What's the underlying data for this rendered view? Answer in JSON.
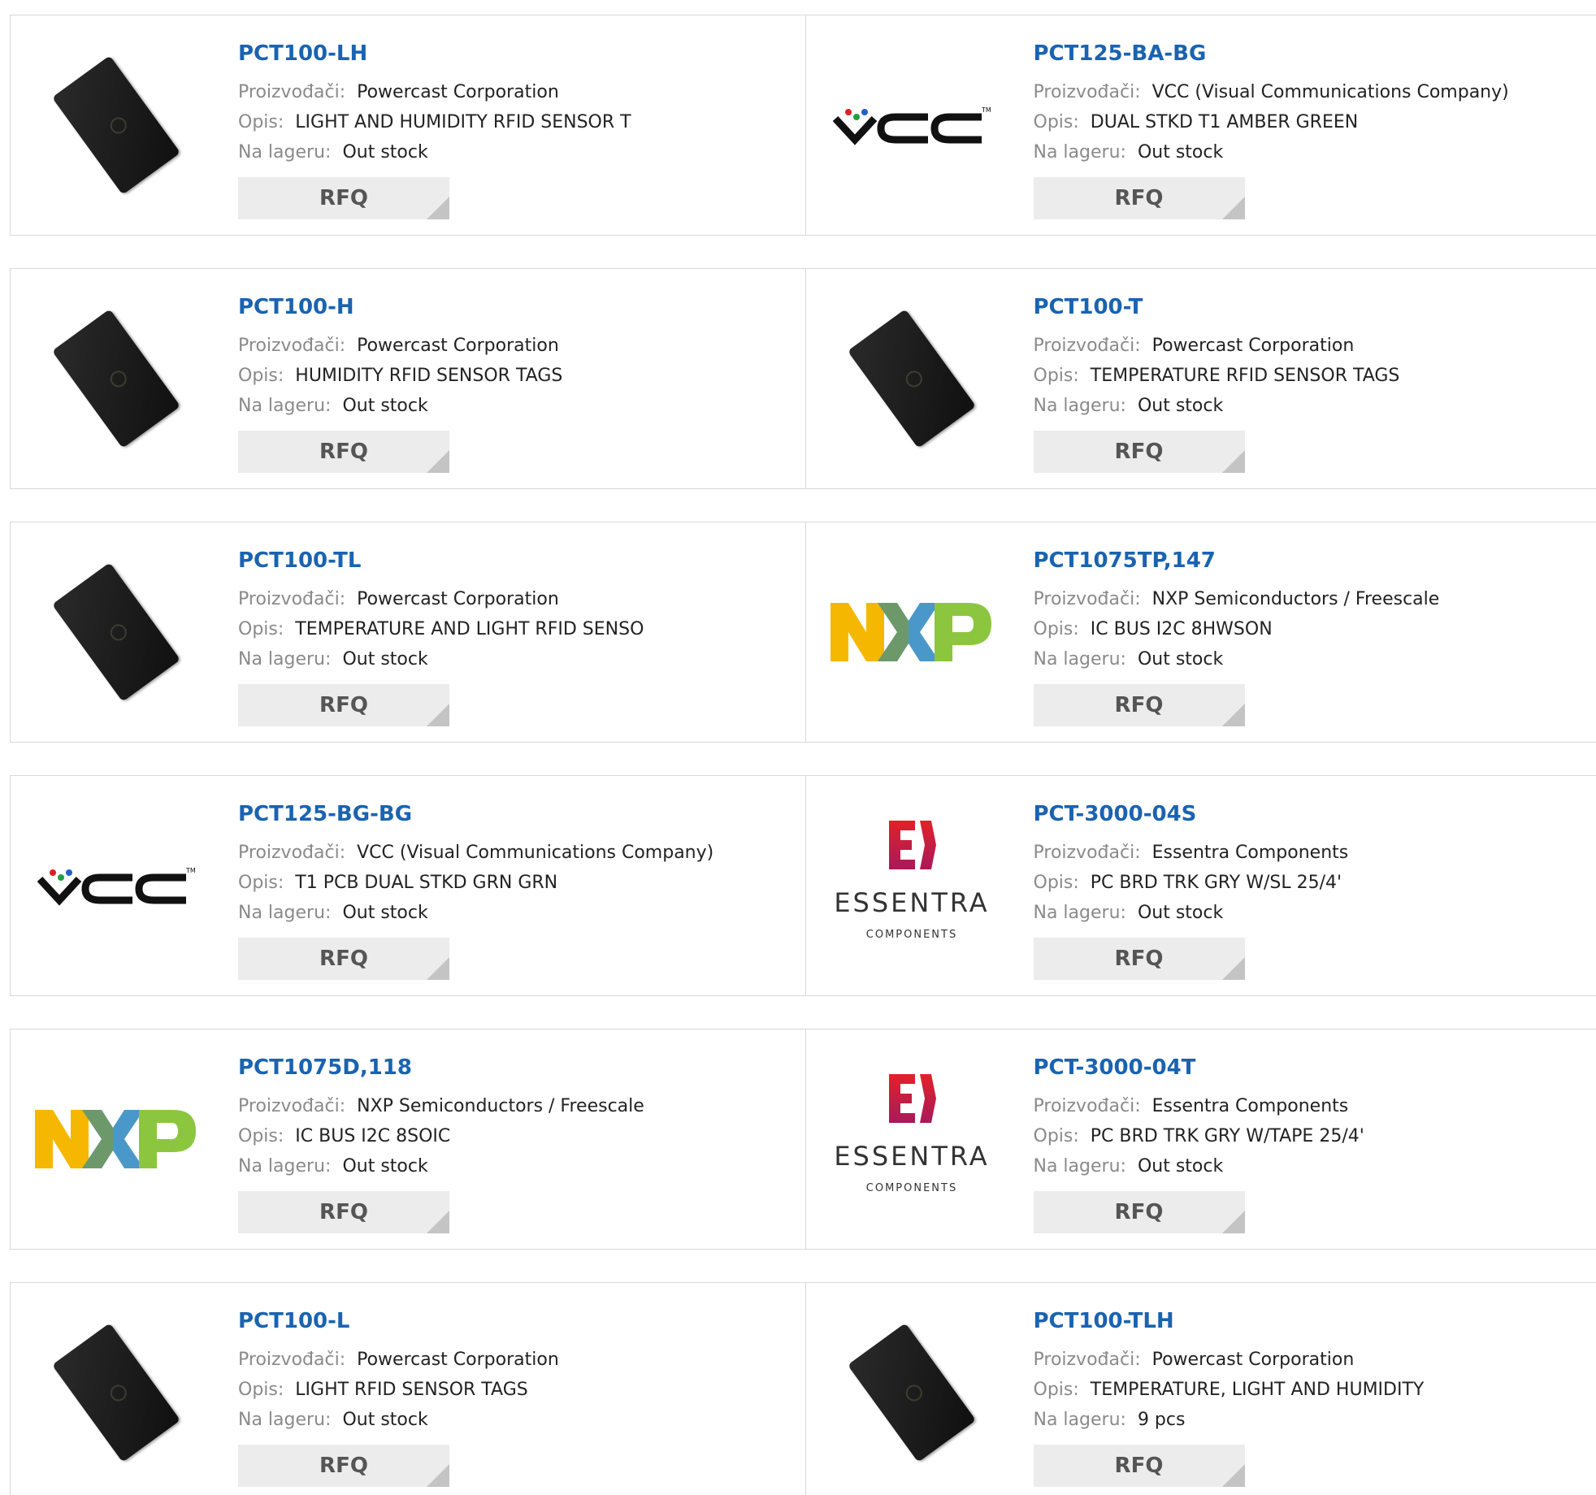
{
  "labels": {
    "manufacturer": "Proizvođači:",
    "description": "Opis:",
    "stock": "Na lageru:",
    "rfq": "RFQ"
  },
  "colors": {
    "title_link": "#1a63b0",
    "label_gray": "#8a8a8a",
    "button_bg": "#ececec",
    "border": "#d9d9d9"
  },
  "products": [
    {
      "part": "PCT100-LH",
      "manufacturer": "Powercast Corporation",
      "description": "LIGHT AND HUMIDITY RFID SENSOR T",
      "stock": "Out stock",
      "logo": "powercast-tag-icon"
    },
    {
      "part": "PCT125-BA-BG",
      "manufacturer": "VCC (Visual Communications Company)",
      "description": "DUAL STKD T1 AMBER GREEN",
      "stock": "Out stock",
      "logo": "vcc-logo",
      "logo_text": "VCC"
    },
    {
      "part": "PCT100-H",
      "manufacturer": "Powercast Corporation",
      "description": "HUMIDITY RFID SENSOR TAGS",
      "stock": "Out stock",
      "logo": "powercast-tag-icon"
    },
    {
      "part": "PCT100-T",
      "manufacturer": "Powercast Corporation",
      "description": "TEMPERATURE RFID SENSOR TAGS",
      "stock": "Out stock",
      "logo": "powercast-tag-icon"
    },
    {
      "part": "PCT100-TL",
      "manufacturer": "Powercast Corporation",
      "description": "TEMPERATURE AND LIGHT RFID SENSO",
      "stock": "Out stock",
      "logo": "powercast-tag-icon"
    },
    {
      "part": "PCT1075TP,147",
      "manufacturer": "NXP Semiconductors / Freescale",
      "description": "IC BUS I2C 8HWSON",
      "stock": "Out stock",
      "logo": "nxp-logo",
      "logo_text": "NXP"
    },
    {
      "part": "PCT125-BG-BG",
      "manufacturer": "VCC (Visual Communications Company)",
      "description": "T1 PCB DUAL STKD GRN GRN",
      "stock": "Out stock",
      "logo": "vcc-logo",
      "logo_text": "VCC"
    },
    {
      "part": "PCT-3000-04S",
      "manufacturer": "Essentra Components",
      "description": "PC BRD TRK GRY W/SL 25/4'",
      "stock": "Out stock",
      "logo": "essentra-logo",
      "logo_text": "ESSENTRA",
      "logo_sub": "COMPONENTS"
    },
    {
      "part": "PCT1075D,118",
      "manufacturer": "NXP Semiconductors / Freescale",
      "description": "IC BUS I2C 8SOIC",
      "stock": "Out stock",
      "logo": "nxp-logo",
      "logo_text": "NXP"
    },
    {
      "part": "PCT-3000-04T",
      "manufacturer": "Essentra Components",
      "description": "PC BRD TRK GRY W/TAPE 25/4'",
      "stock": "Out stock",
      "logo": "essentra-logo",
      "logo_text": "ESSENTRA",
      "logo_sub": "COMPONENTS"
    },
    {
      "part": "PCT100-L",
      "manufacturer": "Powercast Corporation",
      "description": "LIGHT RFID SENSOR TAGS",
      "stock": "Out stock",
      "logo": "powercast-tag-icon"
    },
    {
      "part": "PCT100-TLH",
      "manufacturer": "Powercast Corporation",
      "description": "TEMPERATURE, LIGHT AND HUMIDITY",
      "stock": "9 pcs",
      "logo": "powercast-tag-icon"
    }
  ]
}
